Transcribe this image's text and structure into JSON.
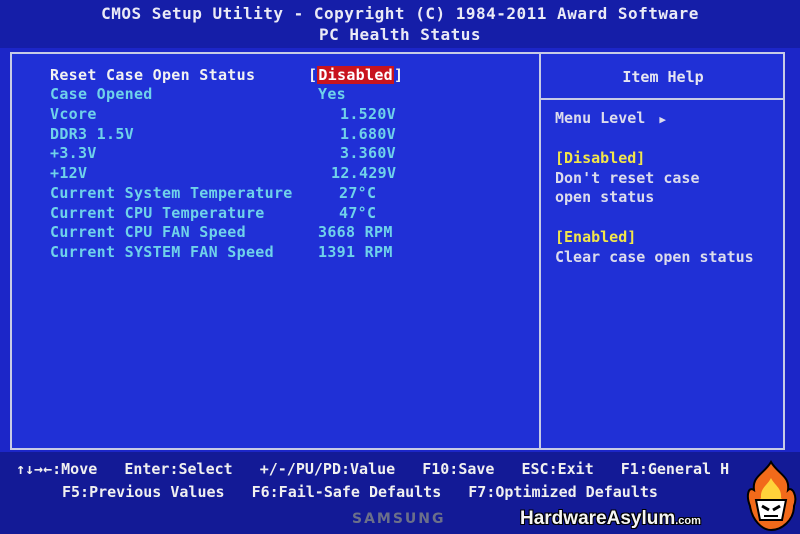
{
  "header": {
    "title": "CMOS Setup Utility - Copyright (C) 1984-2011 Award Software",
    "subtitle": "PC Health Status"
  },
  "settings": [
    {
      "label": "Reset Case Open Status",
      "value_prefix": "[",
      "value": "Disabled",
      "value_suffix": "]",
      "selected": true
    },
    {
      "label": "Case Opened",
      "value": "Yes"
    },
    {
      "label": "Vcore",
      "value": "1.520V"
    },
    {
      "label": "DDR3 1.5V",
      "value": "1.680V"
    },
    {
      "label": "+3.3V",
      "value": "3.360V"
    },
    {
      "label": "+12V",
      "value": "12.429V"
    },
    {
      "label": "Current System Temperature",
      "value": "27°C"
    },
    {
      "label": "Current CPU Temperature",
      "value": "47°C"
    },
    {
      "label": "Current CPU FAN Speed",
      "value": "3668 RPM"
    },
    {
      "label": "Current SYSTEM FAN Speed",
      "value": "1391 RPM"
    }
  ],
  "help": {
    "title": "Item Help",
    "menu_level": "Menu Level",
    "menu_level_arrow": "▶",
    "option1_name": "[Disabled]",
    "option1_desc_line1": "Don't reset case",
    "option1_desc_line2": "open status",
    "option2_name": "[Enabled]",
    "option2_desc": "Clear case open status"
  },
  "footer": {
    "row1": [
      "↑↓→←:Move",
      "Enter:Select",
      "+/-/PU/PD:Value",
      "F10:Save",
      "ESC:Exit",
      "F1:General H"
    ],
    "row2": [
      "F5:Previous Values",
      "F6:Fail-Safe Defaults",
      "F7:Optimized Defaults"
    ]
  },
  "monitor_brand": "SAMSUNG",
  "watermark": {
    "text": "HardwareAsylum",
    "suffix": ".com"
  },
  "colors": {
    "background": "#1c26c8",
    "label": "#6fd2ea",
    "selected": "#f2f2f2",
    "highlight": "#c8141e",
    "help_option": "#f2e64a"
  }
}
